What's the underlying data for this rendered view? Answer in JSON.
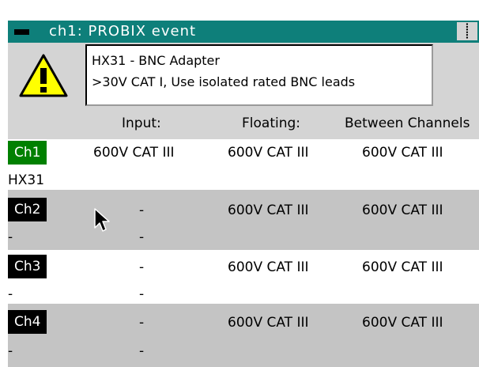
{
  "window": {
    "title": "ch1: PROBIX event"
  },
  "message": {
    "line1": "HX31 - BNC Adapter",
    "line2": ">30V CAT I, Use isolated rated BNC leads"
  },
  "headers": {
    "input": "Input:",
    "floating": "Floating:",
    "between": "Between Channels"
  },
  "channels": [
    {
      "label": "Ch1",
      "active": true,
      "input": "600V CAT III",
      "floating": "600V CAT III",
      "between": "600V CAT III",
      "probe": "HX31",
      "probe_input": ""
    },
    {
      "label": "Ch2",
      "active": false,
      "input": "-",
      "floating": "600V CAT III",
      "between": "600V CAT III",
      "probe": "-",
      "probe_input": "-"
    },
    {
      "label": "Ch3",
      "active": false,
      "input": "-",
      "floating": "600V CAT III",
      "between": "600V CAT III",
      "probe": "-",
      "probe_input": "-"
    },
    {
      "label": "Ch4",
      "active": false,
      "input": "-",
      "floating": "600V CAT III",
      "between": "600V CAT III",
      "probe": "-",
      "probe_input": "-"
    }
  ],
  "colors": {
    "titlebar": "#0e7f7a",
    "active_channel": "#008000",
    "inactive_channel": "#000000",
    "warning": "#ffff00"
  },
  "icons": {
    "title_menu": "window-menu-icon",
    "close": "close-icon",
    "warning": "warning-icon",
    "cursor": "mouse-pointer-icon"
  }
}
